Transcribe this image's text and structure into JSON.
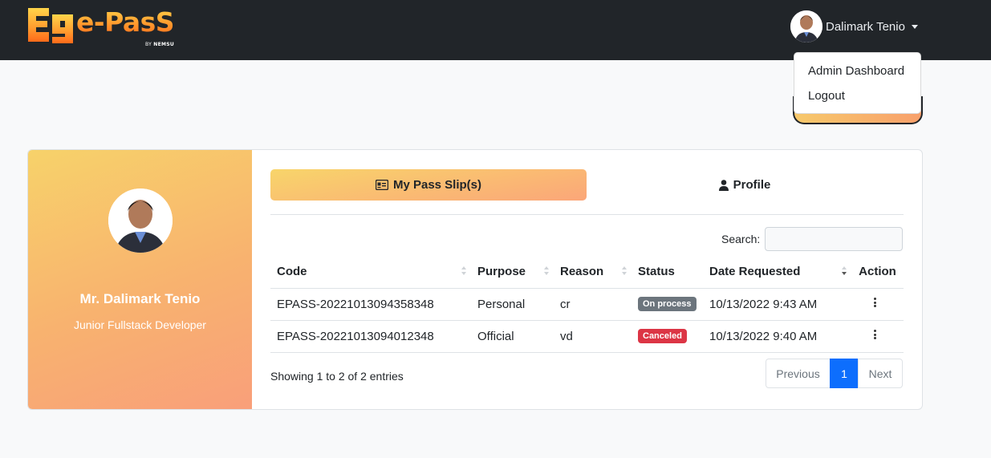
{
  "brand": {
    "logo_text": "e-PasS",
    "logo_by": "BY",
    "logo_org": "NEMSU"
  },
  "user_menu": {
    "name": "Dalimark Tenio",
    "items": [
      "Admin Dashboard",
      "Logout"
    ]
  },
  "profile": {
    "name": "Mr. Dalimark Tenio",
    "title": "Junior Fullstack Developer"
  },
  "tabs": [
    {
      "label": "My Pass Slip(s)",
      "icon": "id-card-icon"
    },
    {
      "label": "Profile",
      "icon": "user-icon"
    }
  ],
  "search": {
    "label": "Search:",
    "value": ""
  },
  "table": {
    "headers": [
      "Code",
      "Purpose",
      "Reason",
      "Status",
      "Date Requested",
      "Action"
    ],
    "rows": [
      {
        "code": "EPASS-20221013094358348",
        "purpose": "Personal",
        "reason": "cr",
        "status": "On process",
        "date": "10/13/2022 9:43 AM"
      },
      {
        "code": "EPASS-20221013094012348",
        "purpose": "Official",
        "reason": "vd",
        "status": "Canceled",
        "date": "10/13/2022 9:40 AM"
      }
    ]
  },
  "colors": {
    "on_process": "#6c757d",
    "canceled": "#dc3545",
    "active_page": "#0d6efd"
  },
  "pagination": {
    "info": "Showing 1 to 2 of 2 entries",
    "previous": "Previous",
    "page": "1",
    "next": "Next"
  }
}
